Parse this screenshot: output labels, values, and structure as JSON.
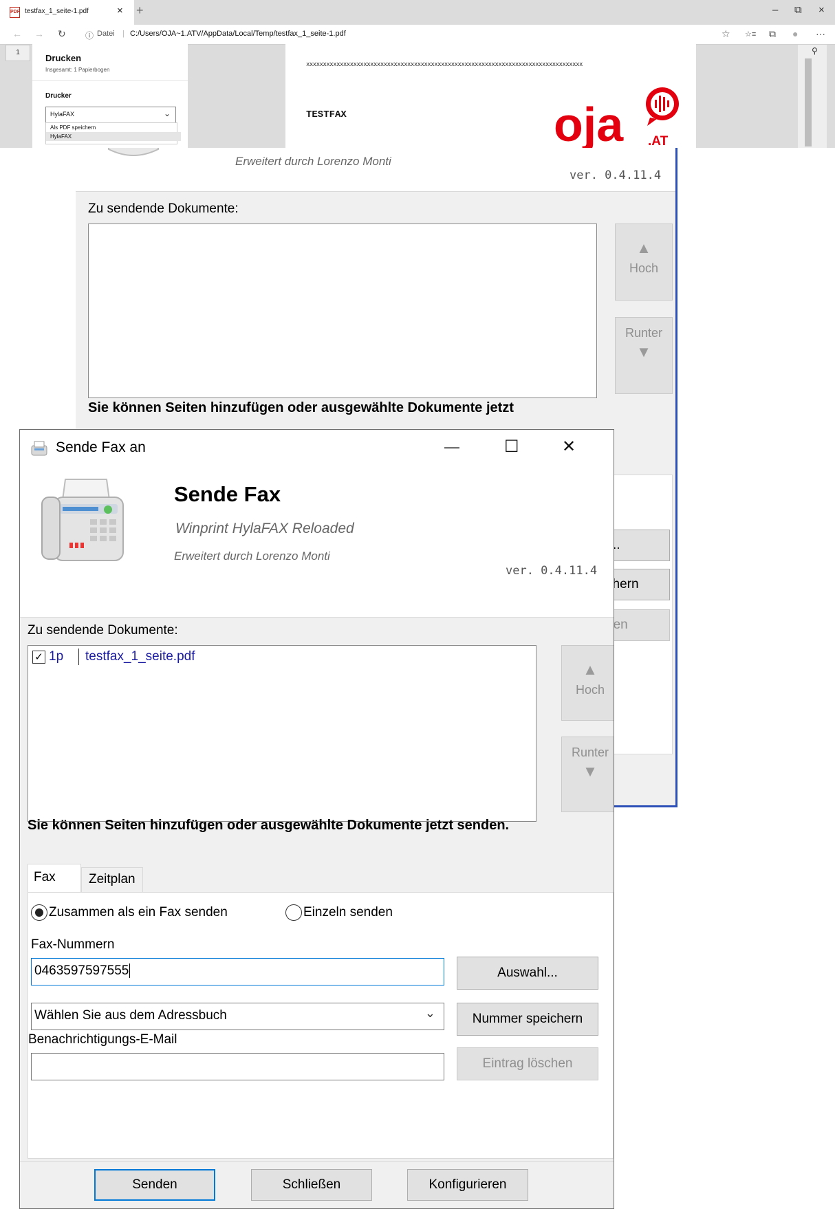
{
  "browser": {
    "tab_title": "testfax_1_seite-1.pdf",
    "tab_close": "×",
    "new_tab": "+",
    "win_min": "–",
    "win_restore": "⧉",
    "win_close": "×",
    "nav_back": "←",
    "nav_forward": "→",
    "nav_refresh": "↻",
    "info_icon": "ⓘ",
    "scheme_label": "Datei",
    "url": "C:/Users/OJA~1.ATV/AppData/Local/Temp/testfax_1_seite-1.pdf",
    "toolbar_icons": [
      "☆",
      "☆≡",
      "⧉",
      "●",
      "···"
    ],
    "page_thumb": "1",
    "pin_icon": "📌"
  },
  "print_panel": {
    "title": "Drucken",
    "subtitle": "Insgesamt: 1 Papierbogen",
    "printer_label": "Drucker",
    "printer_value": "HylaFAX",
    "options": [
      "Als PDF speichern",
      "HylaFAX"
    ]
  },
  "pdf_page": {
    "xline": "xxxxxxxxxxxxxxxxxxxxxxxxxxxxxxxxxxxxxxxxxxxxxxxxxxxxxxxxxxxxxxxxxxxxxxxxxxxxxxxxxx",
    "heading": "TESTFAX",
    "logo_text": "oja",
    "logo_sub": ".AT",
    "brand_color": "#e3000f"
  },
  "back_window": {
    "subtitle2": "Erweitert durch Lorenzo Monti",
    "version": "ver. 0.4.11.4",
    "documents_label": "Zu sendende Dokumente:",
    "up_label": "Hoch",
    "down_label": "Runter",
    "hint_partial": "Sie können Seiten hinzufügen oder ausgewählte Dokumente jetzt",
    "peek_auswahl": "..",
    "peek_speichern": "chern",
    "peek_loeschen": "hen"
  },
  "front_window": {
    "window_title": "Sende Fax an",
    "min": "—",
    "max": "☐",
    "close": "✕",
    "title": "Sende Fax",
    "subtitle": "Winprint HylaFAX Reloaded",
    "subtitle2": "Erweitert durch Lorenzo Monti",
    "version": "ver. 0.4.11.4",
    "documents_label": "Zu sendende Dokumente:",
    "documents": [
      {
        "checked": true,
        "pages": "1p",
        "file": "testfax_1_seite.pdf"
      }
    ],
    "up_label": "Hoch",
    "down_label": "Runter",
    "hint": "Sie können Seiten hinzufügen oder ausgewählte Dokumente jetzt senden.",
    "tabs": [
      "Fax",
      "Zeitplan"
    ],
    "radio_together": "Zusammen als ein Fax senden",
    "radio_single": "Einzeln senden",
    "fax_numbers_label": "Fax-Nummern",
    "fax_number_value": "0463597597555",
    "auswahl_btn": "Auswahl...",
    "addressbook_value": "Wählen Sie aus dem Adressbuch",
    "save_number_btn": "Nummer speichern",
    "email_label": "Benachrichtigungs-E-Mail",
    "email_value": "",
    "delete_btn": "Eintrag löschen",
    "send_btn": "Senden",
    "close_btn": "Schließen",
    "configure_btn": "Konfigurieren"
  }
}
